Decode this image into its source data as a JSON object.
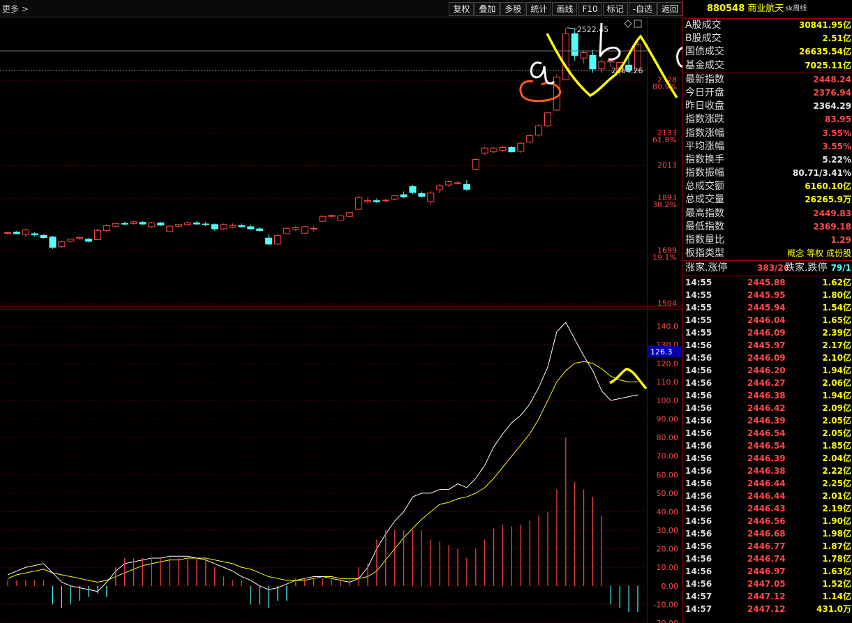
{
  "toolbar": {
    "more": "更多 >",
    "buttons": [
      "复权",
      "叠加",
      "多股",
      "统计",
      "画线",
      "F10",
      "标记",
      "-自选",
      "返回"
    ]
  },
  "colors": {
    "up": "#ff4848",
    "down": "#54fcfc",
    "ma1": "#ffffff",
    "ma2": "#ffff00",
    "accent": "#ffff00",
    "grid": "#8b0000"
  },
  "chart_data": [
    {
      "type": "candlestick",
      "title": "",
      "annotations": [
        "2522.45",
        "2364.26"
      ],
      "y_ticks": [
        {
          "v": 1504,
          "label": "1504"
        },
        {
          "v": 1699,
          "label": "1699"
        },
        {
          "v": 1699,
          "label": "19.1%"
        },
        {
          "v": 1893,
          "label": "1893"
        },
        {
          "v": 1893,
          "label": "38.2%"
        },
        {
          "v": 2013,
          "label": "2013"
        },
        {
          "v": 2133,
          "label": "2133"
        },
        {
          "v": 2133,
          "label": "61.8%"
        },
        {
          "v": 2328,
          "label": "2328"
        },
        {
          "v": 2328,
          "label": "80.9%"
        }
      ],
      "ylim": [
        1497,
        2560
      ],
      "candles": [
        [
          1764,
          1770,
          1759,
          1766
        ],
        [
          1768,
          1772,
          1760,
          1762
        ],
        [
          1760,
          1780,
          1750,
          1776
        ],
        [
          1762,
          1768,
          1752,
          1758
        ],
        [
          1756,
          1760,
          1744,
          1748
        ],
        [
          1750,
          1754,
          1706,
          1712
        ],
        [
          1714,
          1736,
          1710,
          1732
        ],
        [
          1734,
          1744,
          1730,
          1742
        ],
        [
          1744,
          1752,
          1740,
          1748
        ],
        [
          1742,
          1746,
          1730,
          1734
        ],
        [
          1740,
          1780,
          1738,
          1774
        ],
        [
          1774,
          1796,
          1770,
          1792
        ],
        [
          1790,
          1802,
          1786,
          1800
        ],
        [
          1800,
          1806,
          1794,
          1798
        ],
        [
          1800,
          1810,
          1796,
          1806
        ],
        [
          1804,
          1808,
          1794,
          1798
        ],
        [
          1788,
          1806,
          1784,
          1802
        ],
        [
          1802,
          1806,
          1790,
          1794
        ],
        [
          1770,
          1794,
          1768,
          1790
        ],
        [
          1790,
          1800,
          1786,
          1796
        ],
        [
          1796,
          1806,
          1790,
          1802
        ],
        [
          1802,
          1808,
          1794,
          1798
        ],
        [
          1798,
          1806,
          1790,
          1796
        ],
        [
          1796,
          1800,
          1772,
          1780
        ],
        [
          1780,
          1800,
          1776,
          1796
        ],
        [
          1786,
          1800,
          1782,
          1792
        ],
        [
          1792,
          1800,
          1784,
          1788
        ],
        [
          1788,
          1796,
          1776,
          1780
        ],
        [
          1780,
          1786,
          1770,
          1774
        ],
        [
          1746,
          1760,
          1720,
          1724
        ],
        [
          1724,
          1760,
          1720,
          1756
        ],
        [
          1762,
          1786,
          1760,
          1782
        ],
        [
          1778,
          1790,
          1772,
          1784
        ],
        [
          1764,
          1790,
          1762,
          1788
        ],
        [
          1780,
          1790,
          1770,
          1782
        ],
        [
          1808,
          1830,
          1806,
          1826
        ],
        [
          1826,
          1834,
          1818,
          1830
        ],
        [
          1812,
          1830,
          1810,
          1828
        ],
        [
          1826,
          1842,
          1822,
          1840
        ],
        [
          1852,
          1900,
          1850,
          1896
        ],
        [
          1880,
          1896,
          1874,
          1884
        ],
        [
          1884,
          1892,
          1876,
          1880
        ],
        [
          1886,
          1890,
          1878,
          1886
        ],
        [
          1890,
          1904,
          1886,
          1902
        ],
        [
          1906,
          1918,
          1894,
          1898
        ],
        [
          1936,
          1942,
          1908,
          1914
        ],
        [
          1910,
          1918,
          1896,
          1900
        ],
        [
          1880,
          1920,
          1870,
          1912
        ],
        [
          1924,
          1946,
          1912,
          1940
        ],
        [
          1942,
          1958,
          1936,
          1954
        ],
        [
          1950,
          1956,
          1944,
          1950
        ],
        [
          1944,
          1960,
          1920,
          1926
        ],
        [
          2000,
          2040,
          1996,
          2036
        ],
        [
          2060,
          2082,
          2054,
          2078
        ],
        [
          2064,
          2082,
          2060,
          2078
        ],
        [
          2070,
          2084,
          2064,
          2080
        ],
        [
          2080,
          2086,
          2062,
          2064
        ],
        [
          2066,
          2100,
          2060,
          2096
        ],
        [
          2100,
          2130,
          2096,
          2124
        ],
        [
          2126,
          2166,
          2120,
          2160
        ],
        [
          2160,
          2210,
          2156,
          2208
        ],
        [
          2218,
          2350,
          2214,
          2340
        ],
        [
          2330,
          2522,
          2328,
          2500
        ],
        [
          2500,
          2518,
          2400,
          2420
        ],
        [
          2410,
          2436,
          2390,
          2430
        ],
        [
          2420,
          2440,
          2356,
          2370
        ],
        [
          2370,
          2404,
          2356,
          2396
        ],
        [
          2396,
          2410,
          2378,
          2400
        ],
        [
          2360,
          2396,
          2344,
          2394
        ],
        [
          2384,
          2412,
          2356,
          2364
        ],
        [
          2364,
          2470,
          2362,
          2460
        ]
      ]
    },
    {
      "type": "line",
      "title": "",
      "ylim": [
        -20,
        150
      ],
      "y_ticks": [
        -20,
        -10,
        0,
        10,
        20,
        30,
        40,
        50,
        60,
        70,
        80,
        90,
        100,
        110,
        120,
        130,
        140
      ],
      "y_tick_labels": [
        "-20.00",
        "-10.00",
        "0.00",
        "10.00",
        "20.00",
        "30.00",
        "40.00",
        "50.00",
        "60.00",
        "70.00",
        "80.00",
        "90.00",
        "100.0",
        "110.0",
        "120.0",
        "130.0",
        "140.0"
      ],
      "current_value_label": "126.3",
      "series": [
        {
          "values": [
            6,
            8,
            10,
            11,
            12,
            7,
            2,
            0,
            -1,
            -2,
            -3,
            2,
            8,
            12,
            13,
            14,
            15,
            15,
            16,
            16,
            16,
            15,
            14,
            12,
            10,
            8,
            5,
            3,
            0,
            -2,
            -1,
            1,
            3,
            4,
            5,
            5,
            4,
            3,
            2,
            4,
            10,
            20,
            28,
            35,
            40,
            48,
            50,
            50,
            52,
            52,
            55,
            53,
            58,
            65,
            75,
            82,
            88,
            92,
            98,
            107,
            118,
            137,
            142,
            133,
            124,
            116,
            105,
            100,
            101,
            102,
            103
          ]
        },
        {
          "values": [
            4,
            6,
            7,
            8,
            9,
            7,
            6,
            5,
            4,
            3,
            2,
            3,
            5,
            7,
            9,
            11,
            12,
            13,
            14,
            14,
            15,
            15,
            15,
            14,
            13,
            12,
            10,
            9,
            7,
            5,
            4,
            3,
            3,
            3,
            4,
            5,
            5,
            4,
            4,
            4,
            5,
            8,
            14,
            20,
            26,
            31,
            36,
            40,
            44,
            45,
            47,
            48,
            50,
            53,
            58,
            64,
            70,
            76,
            82,
            90,
            100,
            110,
            116,
            120,
            121,
            120,
            117,
            113,
            111,
            110,
            110
          ]
        },
        {
          "values": [
            3,
            3,
            3,
            3,
            3,
            -10,
            -12,
            -10,
            -8,
            -6,
            -4,
            -6,
            10,
            15,
            15,
            15,
            15,
            15,
            15,
            15,
            15,
            15,
            15,
            10,
            5,
            3,
            3,
            -10,
            -10,
            -12,
            -8,
            -8,
            4,
            4,
            4,
            4,
            4,
            4,
            4,
            10,
            12,
            25,
            30,
            30,
            30,
            30,
            30,
            25,
            24,
            22,
            20,
            15,
            20,
            25,
            31,
            33,
            32,
            33,
            35,
            38,
            40,
            52,
            80,
            56,
            52,
            48,
            38,
            -10,
            -12,
            -14,
            -14
          ]
        }
      ]
    }
  ],
  "panel": {
    "code": "880548",
    "name": "商业航天",
    "period": "sk周线",
    "rows1": [
      {
        "label": "A股成交",
        "value": "30841.95亿",
        "color": "yellow"
      },
      {
        "label": "B股成交",
        "value": "2.51亿",
        "color": "yellow"
      },
      {
        "label": "国债成交",
        "value": "26635.54亿",
        "color": "yellow"
      },
      {
        "label": "基金成交",
        "value": "7025.11亿",
        "color": "yellow"
      }
    ],
    "rows2": [
      {
        "label": "最新指数",
        "value": "2448.24",
        "color": "red"
      },
      {
        "label": "今日开盘",
        "value": "2376.94",
        "color": "red"
      },
      {
        "label": "昨日收盘",
        "value": "2364.29",
        "color": "white"
      },
      {
        "label": "指数涨跌",
        "value": "83.95",
        "color": "red"
      },
      {
        "label": "指数涨幅",
        "value": "3.55%",
        "color": "red"
      },
      {
        "label": "平均涨幅",
        "value": "3.55%",
        "color": "red"
      },
      {
        "label": "指数换手",
        "value": "5.22%",
        "color": "white"
      },
      {
        "label": "指数振幅",
        "value": "80.71/3.41%",
        "color": "white"
      },
      {
        "label": "总成交额",
        "value": "6160.10亿",
        "color": "yellow"
      },
      {
        "label": "总成交量",
        "value": "26265.9万",
        "color": "yellow"
      },
      {
        "label": "最高指数",
        "value": "2449.83",
        "color": "red"
      },
      {
        "label": "最低指数",
        "value": "2369.18",
        "color": "red"
      },
      {
        "label": "指数量比",
        "value": "1.29",
        "color": "red"
      },
      {
        "label": "板指类型",
        "value": "",
        "color": "white"
      }
    ],
    "concept": "概念 等权 成份股",
    "up_down": {
      "up_label": "涨家.涨停",
      "up_value": "383/26",
      "down_label": "跌家.跌停",
      "down_value": "79/1"
    },
    "ticks": [
      {
        "t": "14:55",
        "p": "2445.88",
        "v": "1.62亿"
      },
      {
        "t": "14:55",
        "p": "2445.95",
        "v": "1.80亿"
      },
      {
        "t": "14:55",
        "p": "2445.94",
        "v": "1.54亿"
      },
      {
        "t": "14:55",
        "p": "2446.04",
        "v": "1.65亿"
      },
      {
        "t": "14:55",
        "p": "2446.09",
        "v": "2.39亿"
      },
      {
        "t": "14:56",
        "p": "2445.97",
        "v": "2.17亿"
      },
      {
        "t": "14:56",
        "p": "2446.09",
        "v": "2.10亿"
      },
      {
        "t": "14:56",
        "p": "2446.20",
        "v": "1.94亿"
      },
      {
        "t": "14:56",
        "p": "2446.27",
        "v": "2.06亿"
      },
      {
        "t": "14:56",
        "p": "2446.38",
        "v": "1.94亿"
      },
      {
        "t": "14:56",
        "p": "2446.42",
        "v": "2.09亿"
      },
      {
        "t": "14:56",
        "p": "2446.39",
        "v": "2.05亿"
      },
      {
        "t": "14:56",
        "p": "2446.54",
        "v": "2.05亿"
      },
      {
        "t": "14:56",
        "p": "2446.54",
        "v": "1.85亿"
      },
      {
        "t": "14:56",
        "p": "2446.39",
        "v": "2.04亿"
      },
      {
        "t": "14:56",
        "p": "2446.38",
        "v": "2.22亿"
      },
      {
        "t": "14:56",
        "p": "2446.44",
        "v": "2.25亿"
      },
      {
        "t": "14:56",
        "p": "2446.44",
        "v": "2.01亿"
      },
      {
        "t": "14:56",
        "p": "2446.43",
        "v": "2.19亿"
      },
      {
        "t": "14:56",
        "p": "2446.56",
        "v": "1.90亿"
      },
      {
        "t": "14:56",
        "p": "2446.68",
        "v": "1.98亿"
      },
      {
        "t": "14:56",
        "p": "2446.77",
        "v": "1.87亿"
      },
      {
        "t": "14:56",
        "p": "2446.74",
        "v": "1.78亿"
      },
      {
        "t": "14:56",
        "p": "2446.97",
        "v": "1.63亿"
      },
      {
        "t": "14:56",
        "p": "2447.05",
        "v": "1.52亿"
      },
      {
        "t": "14:57",
        "p": "2447.12",
        "v": "1.14亿"
      },
      {
        "t": "14:57",
        "p": "2447.12",
        "v": "431.0万"
      }
    ]
  }
}
